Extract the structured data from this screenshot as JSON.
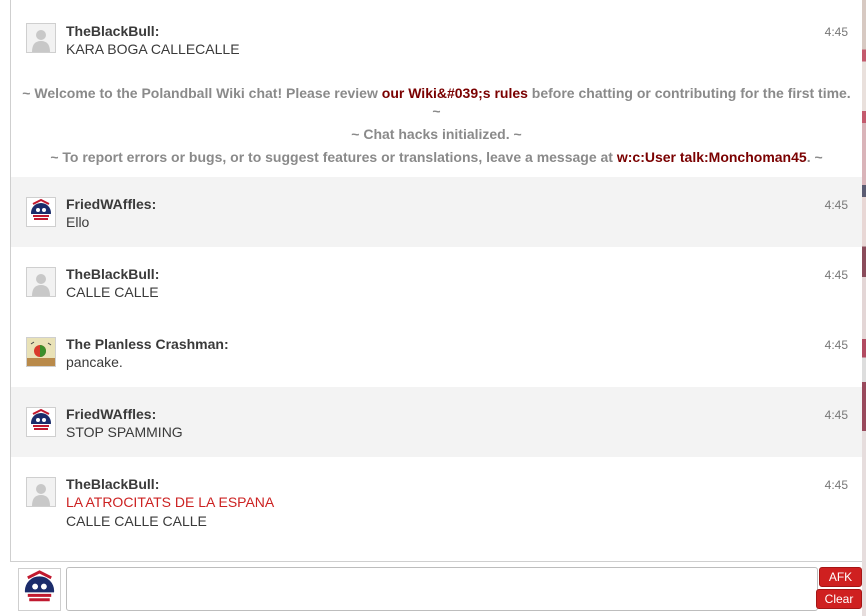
{
  "colors": {
    "link": "#7a0000",
    "alert_text": "#8a8a8a",
    "red_text": "#cc2222",
    "button": "#cf2020",
    "alt_row": "#f3f3f3"
  },
  "alert": {
    "welcome_prefix": "~ Welcome to the Polandball Wiki chat! Please review ",
    "welcome_link": "our Wiki&#039;s rules",
    "welcome_suffix": " before chatting or contributing for the first time.",
    "welcome_tail": "~",
    "hacks": "~ Chat hacks initialized. ~",
    "report_prefix": "~ To report errors or bugs, or to suggest features or translations, leave a message at ",
    "report_link": "w:c:User talk:Monchoman45",
    "report_suffix": ". ~"
  },
  "messages": [
    {
      "user": "TheBlackBull:",
      "lines": [
        "KARA BOGA CALLECALLE"
      ],
      "time": "4:45",
      "avatar": "default-user-icon"
    },
    {
      "user": "FriedWAffles:",
      "lines": [
        "Ello"
      ],
      "time": "4:45",
      "avatar": "ball-avatar-icon"
    },
    {
      "user": "TheBlackBull:",
      "lines": [
        "CALLE CALLE"
      ],
      "time": "4:45",
      "avatar": "default-user-icon"
    },
    {
      "user": "The Planless Crashman:",
      "lines": [
        "pancake."
      ],
      "time": "4:45",
      "avatar": "crashman-avatar-icon"
    },
    {
      "user": "FriedWAffles:",
      "lines": [
        "STOP SPAMMING"
      ],
      "time": "4:45",
      "avatar": "ball-avatar-icon"
    },
    {
      "user": "TheBlackBull:",
      "lines": [
        "LA ATROCITATS DE LA ESPANA",
        "CALLE CALLE CALLE"
      ],
      "time": "4:45",
      "avatar": "default-user-icon"
    }
  ],
  "input": {
    "value": "",
    "afk_label": "AFK",
    "clear_label": "Clear"
  }
}
